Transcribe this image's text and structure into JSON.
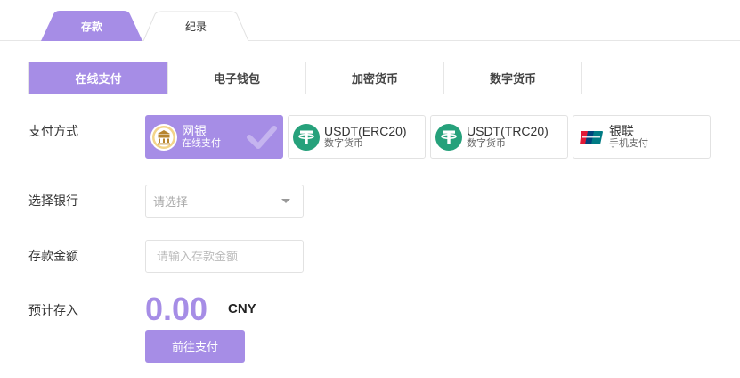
{
  "top_tabs": [
    {
      "label": "存款",
      "active": true
    },
    {
      "label": "纪录",
      "active": false
    }
  ],
  "sub_tabs": [
    {
      "label": "在线支付",
      "active": true
    },
    {
      "label": "电子钱包",
      "active": false
    },
    {
      "label": "加密货币",
      "active": false
    },
    {
      "label": "数字货币",
      "active": false
    }
  ],
  "form": {
    "pay_method_label": "支付方式",
    "bank_label": "选择银行",
    "amount_label": "存款金额",
    "estimate_label": "预计存入"
  },
  "pay_methods": [
    {
      "title": "网银",
      "subtitle": "在线支付",
      "icon": "bank-icon",
      "selected": true
    },
    {
      "title": "USDT(ERC20)",
      "subtitle": "数字货币",
      "icon": "tether-icon",
      "selected": false
    },
    {
      "title": "USDT(TRC20)",
      "subtitle": "数字货币",
      "icon": "tether-icon",
      "selected": false
    },
    {
      "title": "银联",
      "subtitle": "手机支付",
      "icon": "unionpay-icon",
      "selected": false
    }
  ],
  "bank_select": {
    "placeholder": "请选择"
  },
  "amount_input": {
    "placeholder": "请输入存款金额",
    "value": ""
  },
  "estimate": {
    "value": "0.00",
    "currency": "CNY"
  },
  "submit_label": "前往支付",
  "colors": {
    "accent": "#a68de6",
    "tether": "#26a17b"
  }
}
